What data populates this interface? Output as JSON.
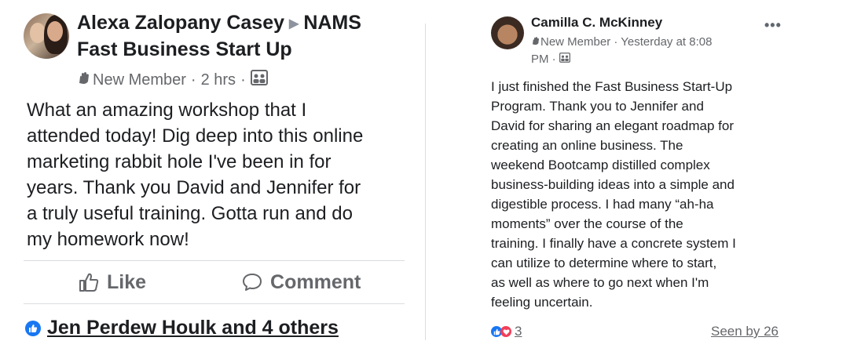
{
  "left_post": {
    "author": "Alexa Zalopany Casey",
    "group": "NAMS Fast Business Start Up",
    "badge": "New Member",
    "time": "2 hrs",
    "body": "What an amazing workshop that I\nattended today!  Dig deep into this online\nmarketing rabbit hole I've been in for\nyears.  Thank you David and Jennifer for\na truly useful training.  Gotta run and do\nmy homework now!",
    "actions": {
      "like": "Like",
      "comment": "Comment"
    },
    "reactors": "Jen Perdew Houlk and 4 others",
    "icons": [
      "new-member-icon",
      "group-privacy-icon",
      "like-icon",
      "comment-icon",
      "like-reaction-icon"
    ]
  },
  "right_post": {
    "author": "Camilla C. McKinney",
    "badge": "New Member",
    "time": "Yesterday at 8:08 PM",
    "meta_line1": "New Member · Yesterday at 8:08",
    "meta_line2": "PM ·",
    "more": "•••",
    "body": "I just finished the Fast Business Start-Up\nProgram. Thank you to Jennifer and\nDavid for sharing an elegant roadmap for\ncreating an online business. The\nweekend Bootcamp distilled complex\nbusiness-building ideas into a simple and\ndigestible process. I had many “ah-ha\nmoments” over the course of the\ntraining. I finally have a concrete system I\ncan utilize to determine where to start,\nas well as where to go next when I'm\nfeeling uncertain.",
    "reaction_count": "3",
    "seen_by": "Seen by 26",
    "icons": [
      "new-member-icon",
      "group-privacy-icon",
      "like-reaction-icon",
      "love-reaction-icon",
      "more-options-icon"
    ]
  },
  "colors": {
    "text": "#1c1e21",
    "secondary": "#65676b",
    "like_blue": "#1877f2",
    "love_red": "#f33e58",
    "divider": "#dadde1"
  }
}
